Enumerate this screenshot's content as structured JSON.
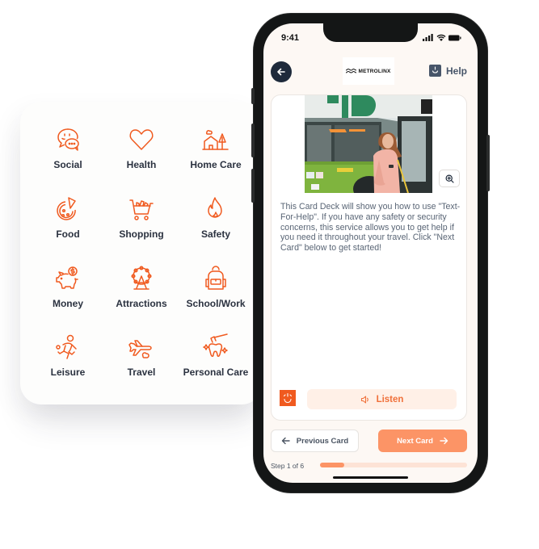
{
  "categories": [
    {
      "label": "Social",
      "icon": "chat-bubbles-icon"
    },
    {
      "label": "Health",
      "icon": "heart-icon"
    },
    {
      "label": "Home Care",
      "icon": "house-tree-icon"
    },
    {
      "label": "Food",
      "icon": "pizza-icon"
    },
    {
      "label": "Shopping",
      "icon": "shopping-cart-icon"
    },
    {
      "label": "Safety",
      "icon": "flame-icon"
    },
    {
      "label": "Money",
      "icon": "piggy-bank-icon"
    },
    {
      "label": "Attractions",
      "icon": "ferris-wheel-icon"
    },
    {
      "label": "School/Work",
      "icon": "backpack-icon"
    },
    {
      "label": "Leisure",
      "icon": "person-playing-icon"
    },
    {
      "label": "Travel",
      "icon": "airplane-icon"
    },
    {
      "label": "Personal Care",
      "icon": "tooth-brush-icon"
    }
  ],
  "colors": {
    "accent": "#F05A1F",
    "accent_soft": "#FC9466",
    "accent_bg": "#FFF0E7",
    "dark_navy": "#1E2A3B",
    "slate": "#475569"
  },
  "phone": {
    "status": {
      "time": "9:41"
    },
    "header": {
      "logo_text": "METROLINX",
      "help_label": "Help"
    },
    "card": {
      "image_alt": "Woman using phone in front of a green bus",
      "description": "This Card Deck will show you how to use \"Text-For-Help\". If you have any safety or security concerns, this service allows you to get help if you need it throughout your travel. Click \"Next Card\" below to get started!",
      "listen_label": "Listen"
    },
    "nav": {
      "prev_label": "Previous Card",
      "next_label": "Next Card"
    },
    "progress": {
      "label": "Step 1 of 6",
      "current": 1,
      "total": 6
    }
  }
}
